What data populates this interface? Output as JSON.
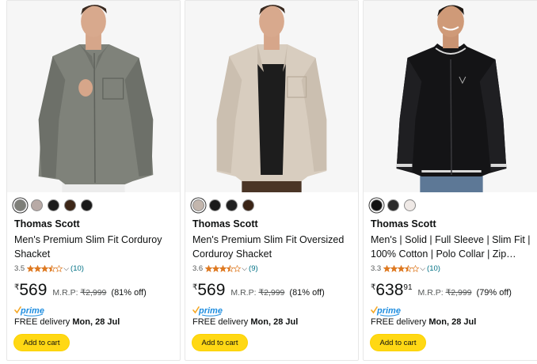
{
  "products": [
    {
      "swatches": [
        "#7e7f79",
        "#b8aaa6",
        "#1b1b1b",
        "#3d2718",
        "#1a1a1a"
      ],
      "selected_swatch": 0,
      "brand": "Thomas Scott",
      "title": "Men's Premium Slim Fit Corduroy Shacket",
      "rating_value": "3.5",
      "rating_stars": 3.5,
      "rating_count": "(10)",
      "currency": "₹",
      "price_whole": "569",
      "price_fraction": "",
      "mrp_label": "M.R.P:",
      "mrp_value": "₹2,999",
      "discount": "(81% off)",
      "prime_label": "prime",
      "delivery_label": "FREE delivery",
      "delivery_date": "Mon, 28 Jul",
      "cart_label": "Add to cart",
      "shirt_color": "#7f827a"
    },
    {
      "swatches": [
        "#c3b6ad",
        "#1a1a1a",
        "#202020",
        "#3b2416"
      ],
      "selected_swatch": 0,
      "brand": "Thomas Scott",
      "title": "Men's Premium Slim Fit Oversized Corduroy Shacket",
      "rating_value": "3.6",
      "rating_stars": 3.5,
      "rating_count": "(9)",
      "currency": "₹",
      "price_whole": "569",
      "price_fraction": "",
      "mrp_label": "M.R.P:",
      "mrp_value": "₹2,999",
      "discount": "(81% off)",
      "prime_label": "prime",
      "delivery_label": "FREE delivery",
      "delivery_date": "Mon, 28 Jul",
      "cart_label": "Add to cart",
      "shirt_color": "#d8cdbf"
    },
    {
      "swatches": [
        "#111111",
        "#2a2a2a",
        "#efe9e6"
      ],
      "selected_swatch": 0,
      "brand": "Thomas Scott",
      "title": "Men's | Solid | Full Sleeve | Slim Fit | 100% Cotton | Polo Collar | Zip…",
      "rating_value": "3.3",
      "rating_stars": 3.5,
      "rating_count": "(10)",
      "currency": "₹",
      "price_whole": "638",
      "price_fraction": "91",
      "mrp_label": "M.R.P:",
      "mrp_value": "₹2,999",
      "discount": "(79% off)",
      "prime_label": "prime",
      "delivery_label": "FREE delivery",
      "delivery_date": "Mon, 28 Jul",
      "cart_label": "Add to cart",
      "shirt_color": "#141416"
    }
  ],
  "colors": {
    "star": "#de7921",
    "link": "#007185",
    "cart_button": "#ffd814",
    "prime_blue": "#1f8ee0"
  }
}
